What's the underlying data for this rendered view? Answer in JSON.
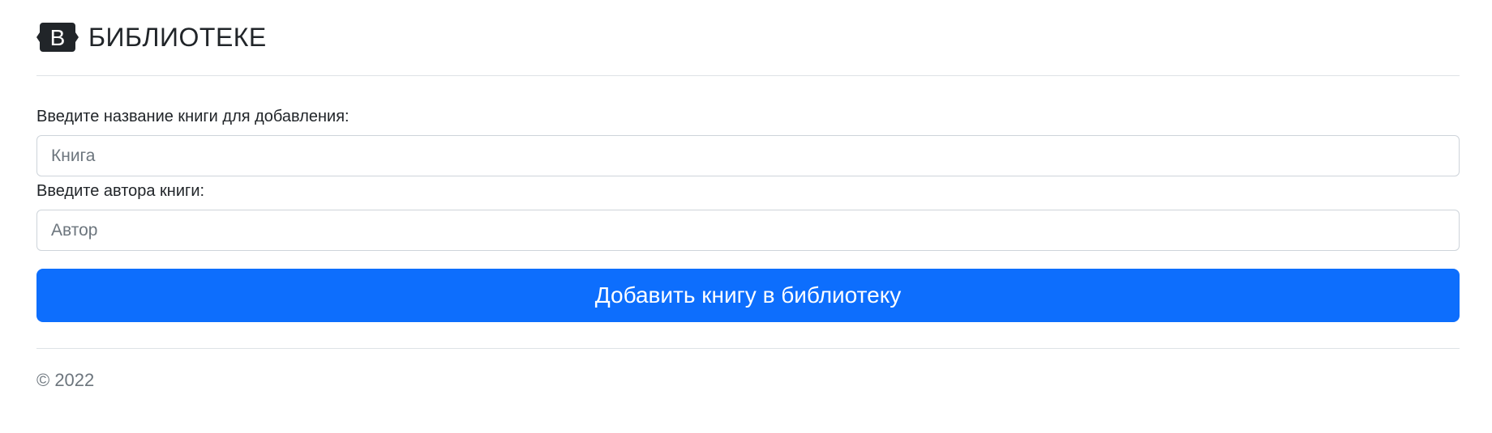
{
  "header": {
    "logo_letter": "B",
    "title": "БИБЛИОТЕКЕ"
  },
  "form": {
    "book_label": "Введите название книги для добавления:",
    "book_placeholder": "Книга",
    "book_value": "",
    "author_label": "Введите автора книги:",
    "author_placeholder": "Автор",
    "author_value": "",
    "submit_label": "Добавить книгу в библиотеку"
  },
  "footer": {
    "copyright": "© 2022"
  },
  "colors": {
    "primary": "#0d6efd",
    "logo_bg": "#212529",
    "muted_text": "#6c757d",
    "border": "#dee2e6"
  },
  "icons": {
    "logo": "bootstrap-logo-icon"
  }
}
